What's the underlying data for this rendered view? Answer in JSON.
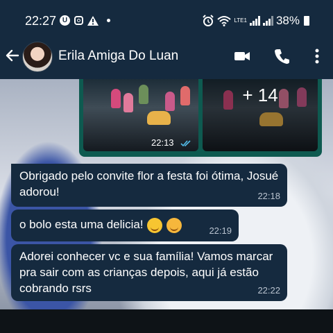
{
  "status_bar": {
    "time": "22:27",
    "network": "LTE1",
    "battery": "38%"
  },
  "header": {
    "contact_name": "Erila Amiga Do Luan"
  },
  "chat": {
    "image_message": {
      "more_count": "+ 14",
      "time": "22:13"
    },
    "messages": [
      {
        "text": "Obrigado pelo convite flor a festa foi ótima, Josué adorou!",
        "time": "22:18"
      },
      {
        "text": "o bolo esta uma delicia!",
        "time": "22:19"
      },
      {
        "text": "Adorei conhecer vc e sua família! Vamos marcar pra sair com as crianças depois, aqui já estão cobrando rsrs",
        "time": "22:22"
      }
    ]
  },
  "colors": {
    "header_bg": "#152a3f",
    "bubble_bg": "#152a3f",
    "image_bubble": "#0e5a50",
    "read_ticks": "#53bdeb"
  },
  "icons": [
    "u-icon",
    "instagram-icon",
    "warning-icon",
    "alarm-icon",
    "wifi-icon",
    "signal-icon",
    "battery-icon",
    "back-arrow-icon",
    "video-call-icon",
    "phone-icon",
    "more-vert-icon",
    "double-check-icon"
  ]
}
